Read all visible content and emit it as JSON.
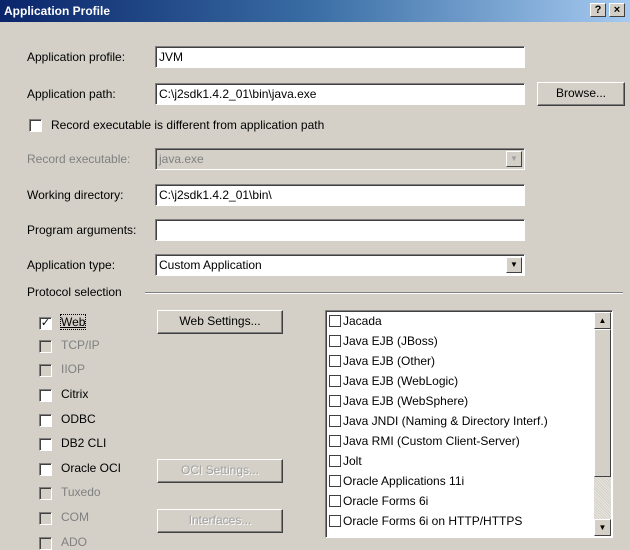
{
  "window": {
    "title": "Application Profile",
    "help_button": "?",
    "close_button": "×"
  },
  "form": {
    "app_profile_label": "Application profile:",
    "app_profile_value": "JVM",
    "app_path_label": "Application path:",
    "app_path_value": "C:\\j2sdk1.4.2_01\\bin\\java.exe",
    "browse_button": "Browse...",
    "record_diff_label": "Record executable is different from application path",
    "record_diff_checked": false,
    "record_exe_label": "Record executable:",
    "record_exe_value": "java.exe",
    "working_dir_label": "Working directory:",
    "working_dir_value": "C:\\j2sdk1.4.2_01\\bin\\",
    "program_args_label": "Program arguments:",
    "program_args_value": "",
    "app_type_label": "Application type:",
    "app_type_value": "Custom Application"
  },
  "protocol": {
    "group_label": "Protocol selection",
    "items": [
      {
        "label": "Web",
        "checked": true,
        "enabled": true
      },
      {
        "label": "TCP/IP",
        "checked": false,
        "enabled": false
      },
      {
        "label": "IIOP",
        "checked": false,
        "enabled": false
      },
      {
        "label": "Citrix",
        "checked": false,
        "enabled": true
      },
      {
        "label": "ODBC",
        "checked": false,
        "enabled": true
      },
      {
        "label": "DB2 CLI",
        "checked": false,
        "enabled": true
      },
      {
        "label": "Oracle OCI",
        "checked": false,
        "enabled": true
      },
      {
        "label": "Tuxedo",
        "checked": false,
        "enabled": false
      },
      {
        "label": "COM",
        "checked": false,
        "enabled": false
      },
      {
        "label": "ADO",
        "checked": false,
        "enabled": false
      }
    ],
    "web_settings_button": "Web Settings...",
    "oci_settings_button": "OCI Settings...",
    "interfaces_button": "Interfaces...",
    "list_items": [
      "Jacada",
      "Java EJB (JBoss)",
      "Java EJB (Other)",
      "Java EJB (WebLogic)",
      "Java EJB (WebSphere)",
      "Java JNDI (Naming & Directory Interf.)",
      "Java RMI (Custom Client-Server)",
      "Jolt",
      "Oracle Applications 11i",
      "Oracle Forms 6i",
      "Oracle Forms 6i on HTTP/HTTPS"
    ]
  },
  "icons": {
    "dropdown": "triangle-down-icon",
    "scroll_up": "triangle-up-icon",
    "scroll_down": "triangle-down-icon",
    "check": "check-icon"
  },
  "colors": {
    "titlebar_start": "#0a246a",
    "titlebar_end": "#a6caf0",
    "face": "#d4d0c8"
  }
}
